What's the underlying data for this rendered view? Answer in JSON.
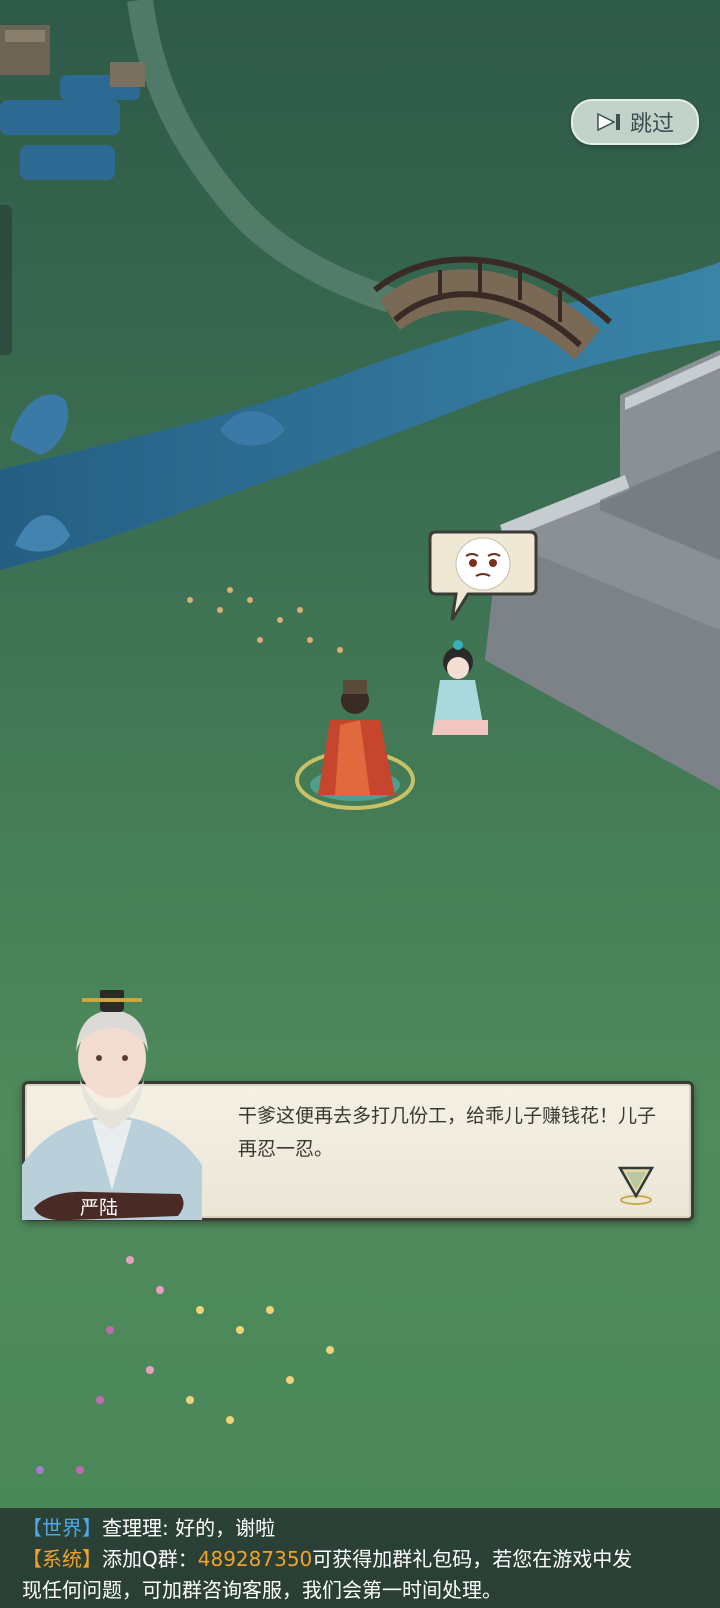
{
  "colors": {
    "grass": "#4f8a5c",
    "river": "#2f6f9a",
    "dialog_bg": "#f1ede1",
    "world_channel": "#4fa7e8",
    "system_channel": "#f0a12b"
  },
  "skip": {
    "label": "跳过",
    "icon": "skip-forward-icon"
  },
  "dialog": {
    "speaker": "严陆",
    "text": "干爹这便再去多打几份工，给乖儿子赚钱花！儿子再忍一忍。",
    "next_icon": "next-triangle-icon"
  },
  "npc_bubble": {
    "icon": "worried-face-emoji-icon"
  },
  "chat": {
    "line1": {
      "channel": "【世界】",
      "user": "查理理",
      "message": ": 好的，谢啦"
    },
    "line2": {
      "channel": "【系统】",
      "text_before": "添加Q群：",
      "qq_number": "489287350",
      "text_after": "可获得加群礼包码，若您在游戏中发"
    },
    "line3": {
      "text": "现任何问题，可加群咨询客服，我们会第一时间处理。"
    }
  }
}
